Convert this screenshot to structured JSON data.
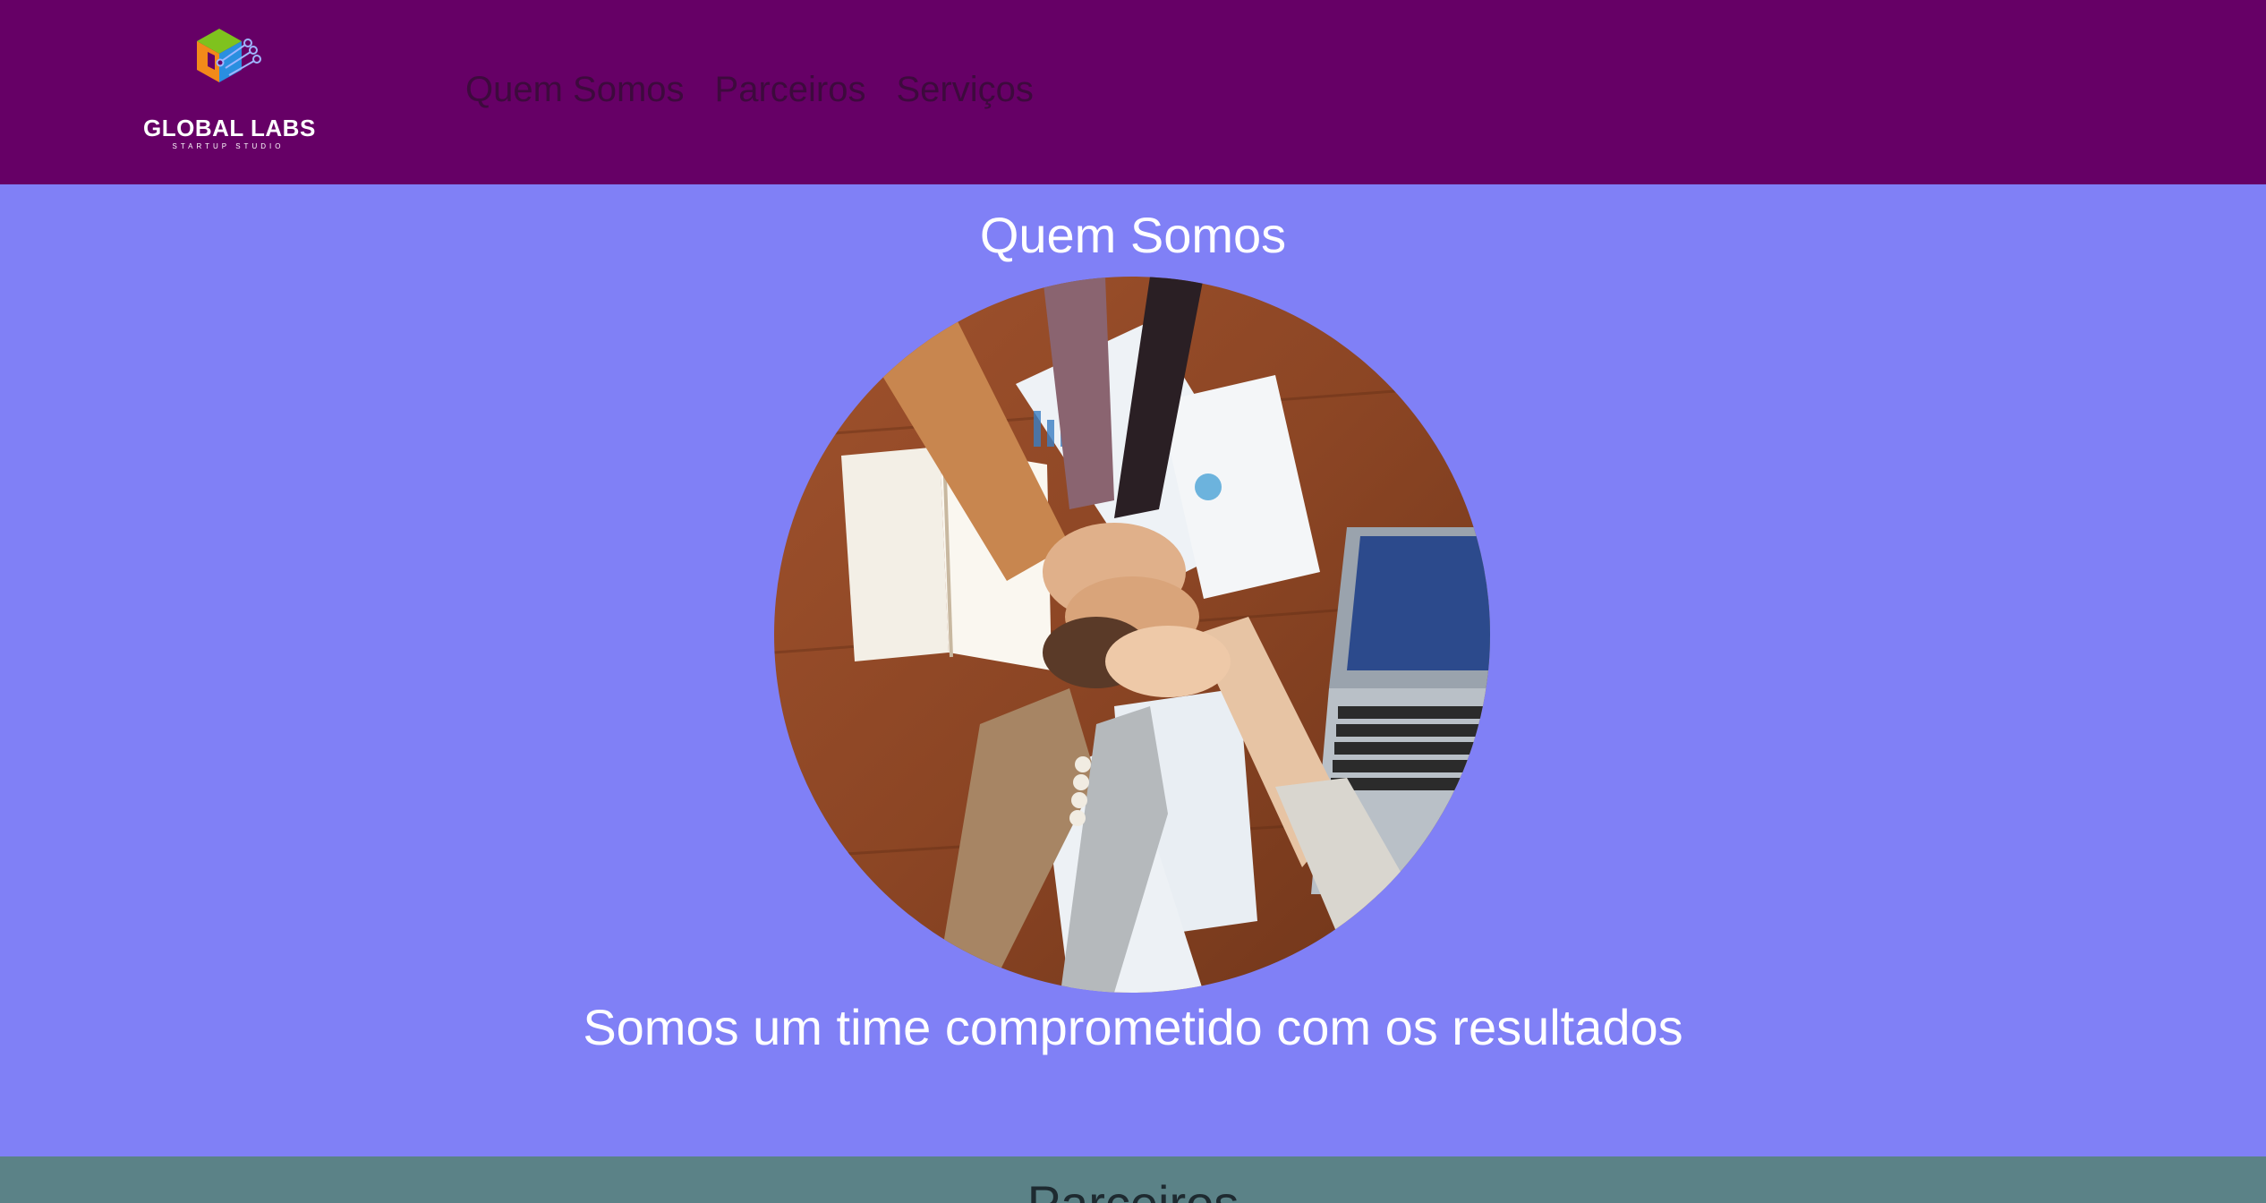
{
  "header": {
    "logo": {
      "title": "GLOBAL LABS",
      "subtitle": "STARTUP STUDIO"
    },
    "nav": [
      {
        "label": "Quem Somos"
      },
      {
        "label": "Parceiros"
      },
      {
        "label": "Serviços"
      }
    ]
  },
  "about": {
    "title": "Quem Somos",
    "image_alt": "team-hands-together-photo",
    "tagline": "Somos um time comprometido com os resultados"
  },
  "partners": {
    "title": "Parceiros"
  },
  "colors": {
    "header_bg": "#660066",
    "main_bg": "#8080f6",
    "partners_bg": "#5b8287",
    "nav_text": "#3d0a3d"
  }
}
